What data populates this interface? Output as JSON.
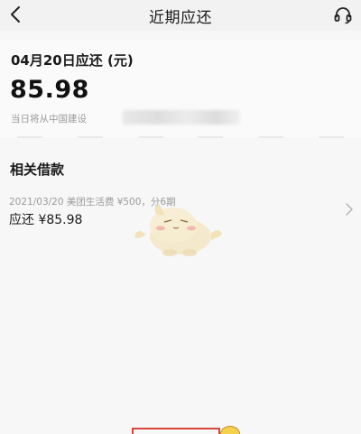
{
  "navbar": {
    "title": "近期应还",
    "back_icon": "chevron-left-icon",
    "service_icon": "headset-icon"
  },
  "due": {
    "title": "04月20日应还 (元)",
    "amount": "85.98",
    "note": "当日将从中国建设"
  },
  "related": {
    "title": "相关借款",
    "items": [
      {
        "meta": "2021/03/20 美团生活费 ¥500，分6期",
        "due": "应还 ¥85.98"
      }
    ]
  },
  "colors": {
    "background": "#f7f7f7",
    "text_primary": "#1a1a1a",
    "text_secondary": "#9a9a9a"
  }
}
